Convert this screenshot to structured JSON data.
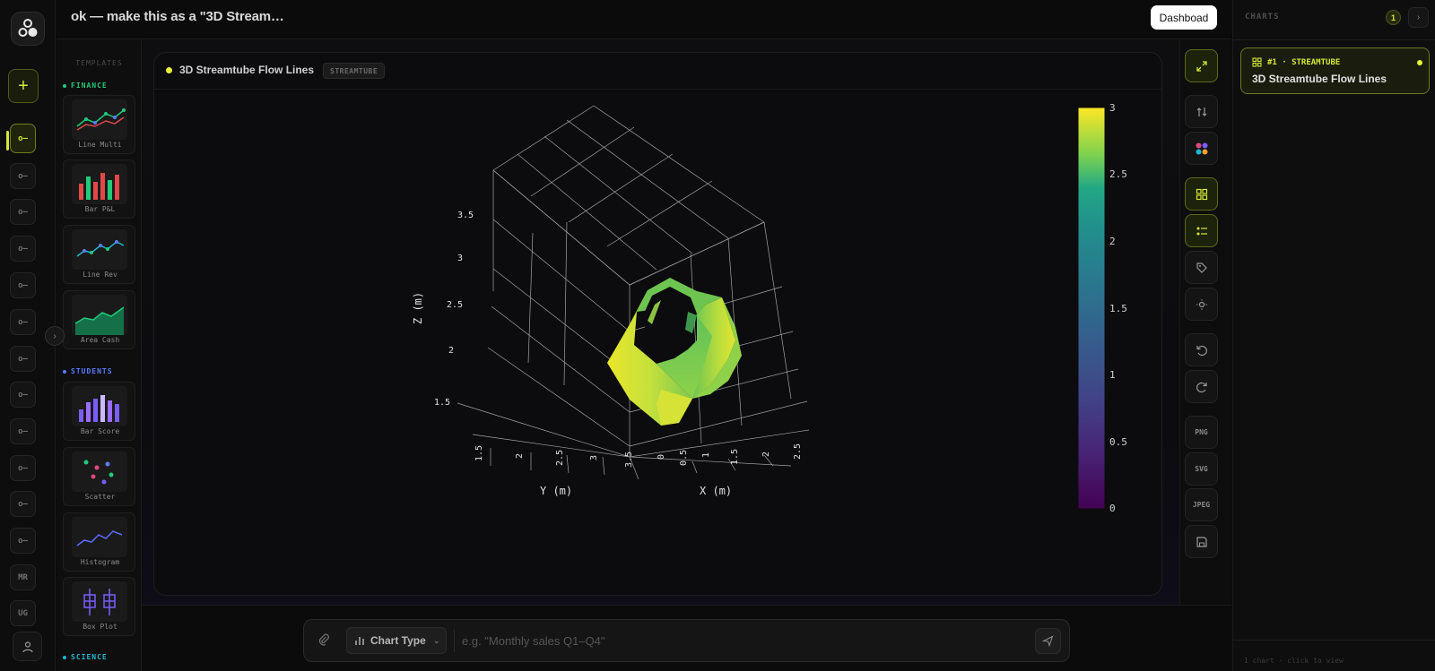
{
  "topbar": {
    "title": "ok — make this as a \"3D Stream…",
    "dashboard_label": "Dashboad"
  },
  "rail": {
    "add_label": "+",
    "items": [
      "o—",
      "o—",
      "o—",
      "o—",
      "o—",
      "o—",
      "o—",
      "o—",
      "o—",
      "o—",
      "o—",
      "o—"
    ],
    "initials": [
      "MR",
      "UG"
    ],
    "expand_label": "›"
  },
  "templates": {
    "heading": "TEMPLATES",
    "categories": [
      {
        "name": "FINANCE",
        "color": "#22c97a"
      },
      {
        "name": "STUDENTS",
        "color": "#5a7cff"
      },
      {
        "name": "SCIENCE",
        "color": "#22b5d0"
      }
    ],
    "cards": [
      {
        "label": "Line Multi",
        "icon": "line-multi-chart-icon"
      },
      {
        "label": "Bar P&L",
        "icon": "bar-pnl-chart-icon"
      },
      {
        "label": "Line Rev",
        "icon": "line-rev-chart-icon"
      },
      {
        "label": "Area Cash",
        "icon": "area-cash-chart-icon"
      },
      {
        "label": "Bar Score",
        "icon": "bar-score-chart-icon"
      },
      {
        "label": "Scatter",
        "icon": "scatter-chart-icon"
      },
      {
        "label": "Histogram",
        "icon": "histogram-chart-icon"
      },
      {
        "label": "Box Plot",
        "icon": "box-plot-chart-icon"
      }
    ]
  },
  "panel": {
    "title": "3D Streamtube Flow Lines",
    "tag": "STREAMTUBE"
  },
  "chart_data": {
    "type": "streamtube",
    "xlabel": "X (m)",
    "ylabel": "Y (m)",
    "zlabel": "Z (m)",
    "x_ticks": [
      "0",
      "0.5",
      "1",
      "1.5",
      "2",
      "2.5"
    ],
    "y_ticks": [
      "1.5",
      "2",
      "2.5",
      "3",
      "3.5"
    ],
    "z_ticks": [
      "1.5",
      "2",
      "2.5",
      "3",
      "3.5"
    ],
    "colorbar": {
      "ticks": [
        "0",
        "0.5",
        "1",
        "1.5",
        "2",
        "2.5",
        "3"
      ],
      "range": [
        0,
        3
      ],
      "colorscale": "viridis"
    },
    "tube": {
      "shape": "ring",
      "value_range": [
        2.2,
        3
      ]
    },
    "grid": true
  },
  "toolbar": {
    "export_labels": [
      "PNG",
      "SVG",
      "JPEG"
    ]
  },
  "composer": {
    "chart_type_label": "Chart Type",
    "placeholder": "e.g. \"Monthly sales Q1–Q4\""
  },
  "right_sidebar": {
    "heading": "CHARTS",
    "count": "1",
    "next_label": "›",
    "card": {
      "id": "#1 · STREAMTUBE",
      "title": "3D Streamtube Flow Lines"
    },
    "footer": "1 chart · click to view"
  }
}
